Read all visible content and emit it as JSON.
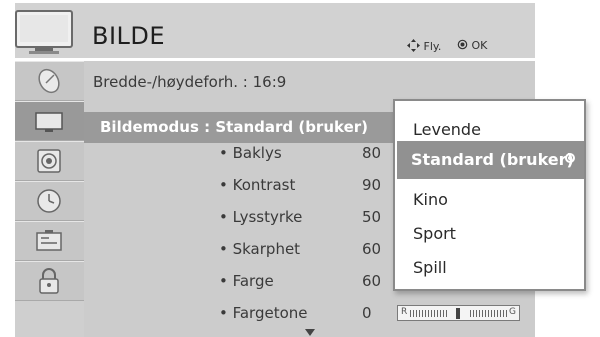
{
  "header": {
    "title": "BILDE",
    "hint_move_label": "Fly.",
    "hint_ok_label": "OK"
  },
  "sidebar": {
    "items": [
      {
        "icon": "satellite-dish-icon"
      },
      {
        "icon": "tv-picture-icon",
        "active": true
      },
      {
        "icon": "speaker-icon"
      },
      {
        "icon": "clock-icon"
      },
      {
        "icon": "options-icon"
      },
      {
        "icon": "lock-icon"
      }
    ]
  },
  "menu": {
    "aspect_ratio": "Bredde-/høydeforh. : 16:9",
    "picture_mode": "Bildemodus : Standard (bruker)",
    "settings": [
      {
        "label": "• Baklys",
        "value": "80"
      },
      {
        "label": "• Kontrast",
        "value": "90"
      },
      {
        "label": "• Lysstyrke",
        "value": "50"
      },
      {
        "label": "• Skarphet",
        "value": "60"
      },
      {
        "label": "• Farge",
        "value": "60"
      },
      {
        "label": "• Fargetone",
        "value": "0"
      }
    ],
    "tint_bar": {
      "left_label": "R",
      "right_label": "G",
      "level": 0.5
    }
  },
  "dropdown": {
    "options": [
      "Levende",
      "Standard (bruker)",
      "Kino",
      "Sport",
      "Spill"
    ],
    "selected": "Standard (bruker)"
  },
  "colors": {
    "header_bg": "#d2d2d2",
    "panel_bg": "#cccccc",
    "highlight": "#9a9a9a",
    "dropdown_bg": "#ffffff"
  }
}
